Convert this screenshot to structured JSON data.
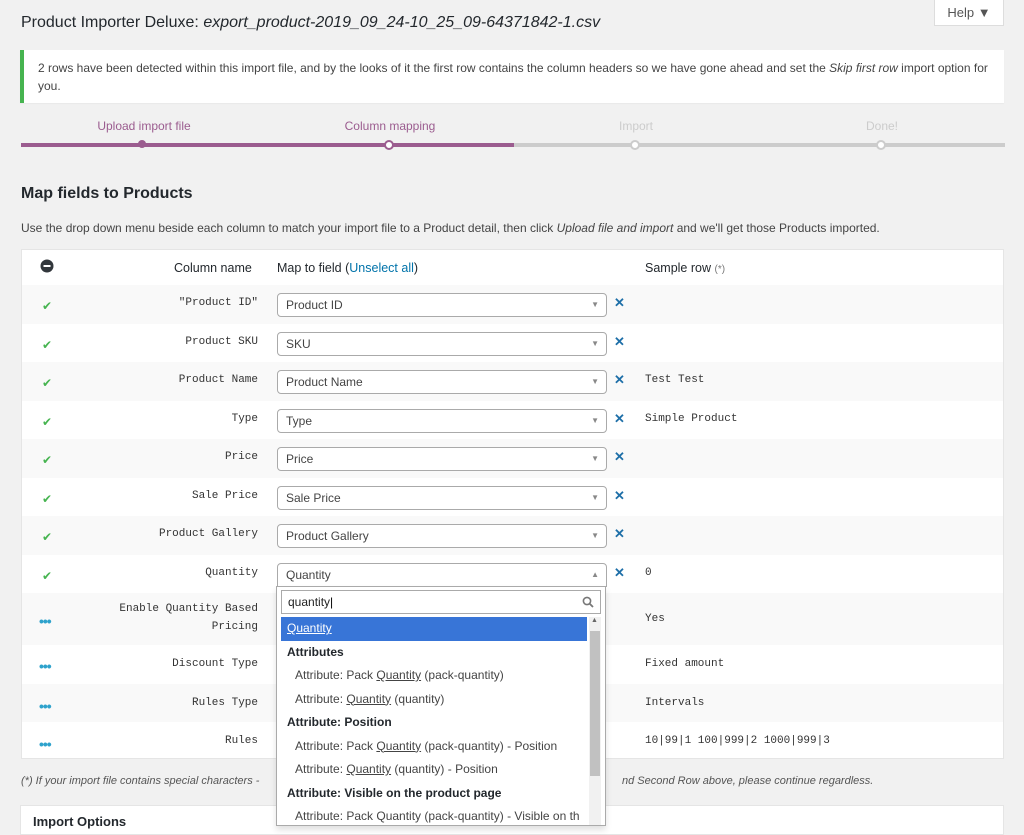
{
  "header": {
    "title_prefix": "Product Importer Deluxe:",
    "filename": "export_product-2019_09_24-10_25_09-64371842-1.csv",
    "help_label": "Help ▼"
  },
  "notice": {
    "text_a": "2 rows have been detected within this import file, and by the looks of it the first row contains the column headers so we have gone ahead and set the ",
    "text_em": "Skip first row",
    "text_b": " import option for you."
  },
  "steps": [
    {
      "label": "Upload import file",
      "state": "done"
    },
    {
      "label": "Column mapping",
      "state": "current"
    },
    {
      "label": "Import",
      "state": "pending"
    },
    {
      "label": "Done!",
      "state": "pending"
    }
  ],
  "colors": {
    "accent": "#9b5c8f",
    "inactive": "#cccccc",
    "ok": "#46b450",
    "link": "#0073aa"
  },
  "section": {
    "title": "Map fields to Products",
    "desc_a": "Use the drop down menu beside each column to match your import file to a Product detail, then click ",
    "desc_em": "Upload file and import",
    "desc_b": " and we'll get those Products imported."
  },
  "table": {
    "col_name": "Column name",
    "map_to": "Map to field (",
    "unselect": "Unselect all",
    "map_close": ")",
    "sample": "Sample row",
    "sample_note": "(*)",
    "rows": [
      {
        "column": "\"Product ID\"",
        "field": "Product ID",
        "sample": ""
      },
      {
        "column": "Product SKU",
        "field": "SKU",
        "sample": ""
      },
      {
        "column": "Product Name",
        "field": "Product Name",
        "sample": "Test Test"
      },
      {
        "column": "Type",
        "field": "Type",
        "sample": "Simple Product"
      },
      {
        "column": "Price",
        "field": "Price",
        "sample": ""
      },
      {
        "column": "Sale Price",
        "field": "Sale Price",
        "sample": ""
      },
      {
        "column": "Product Gallery",
        "field": "Product Gallery",
        "sample": ""
      },
      {
        "column": "Quantity",
        "field": "Quantity",
        "sample": "0"
      },
      {
        "column_a": "Enable Quantity Based",
        "column_b": "Pricing",
        "sample": "Yes"
      },
      {
        "column": "Discount Type",
        "sample": "Fixed amount"
      },
      {
        "column": "Rules Type",
        "sample": "Intervals"
      },
      {
        "column": "Rules",
        "sample": "10|99|1 100|999|2 1000|999|3"
      }
    ]
  },
  "dropdown": {
    "search_value": "quantity",
    "items": [
      {
        "text": "Quantity",
        "kind": "highlight"
      },
      {
        "text": "Attributes",
        "kind": "group"
      },
      {
        "pre": "Attribute: Pack ",
        "match": "Quantity",
        "post": " (pack-quantity)",
        "kind": "sub"
      },
      {
        "pre": "Attribute: ",
        "match": "Quantity",
        "post": " (quantity)",
        "kind": "sub"
      },
      {
        "text": "Attribute: Position",
        "kind": "group"
      },
      {
        "pre": "Attribute: Pack ",
        "match": "Quantity",
        "post": " (pack-quantity) - Position",
        "kind": "sub"
      },
      {
        "pre": "Attribute: ",
        "match": "Quantity",
        "post": " (quantity) - Position",
        "kind": "sub"
      },
      {
        "text": "Attribute: Visible on the product page",
        "kind": "group"
      },
      {
        "pre": "Attribute: Pack Quantity (pack-quantity) - Visible on th",
        "match": "",
        "post": "",
        "kind": "sub"
      }
    ]
  },
  "footnote": {
    "left": "(*) If your import file contains special characters -",
    "right": "nd Second Row above, please continue regardless."
  },
  "import_options": {
    "title": "Import Options"
  }
}
